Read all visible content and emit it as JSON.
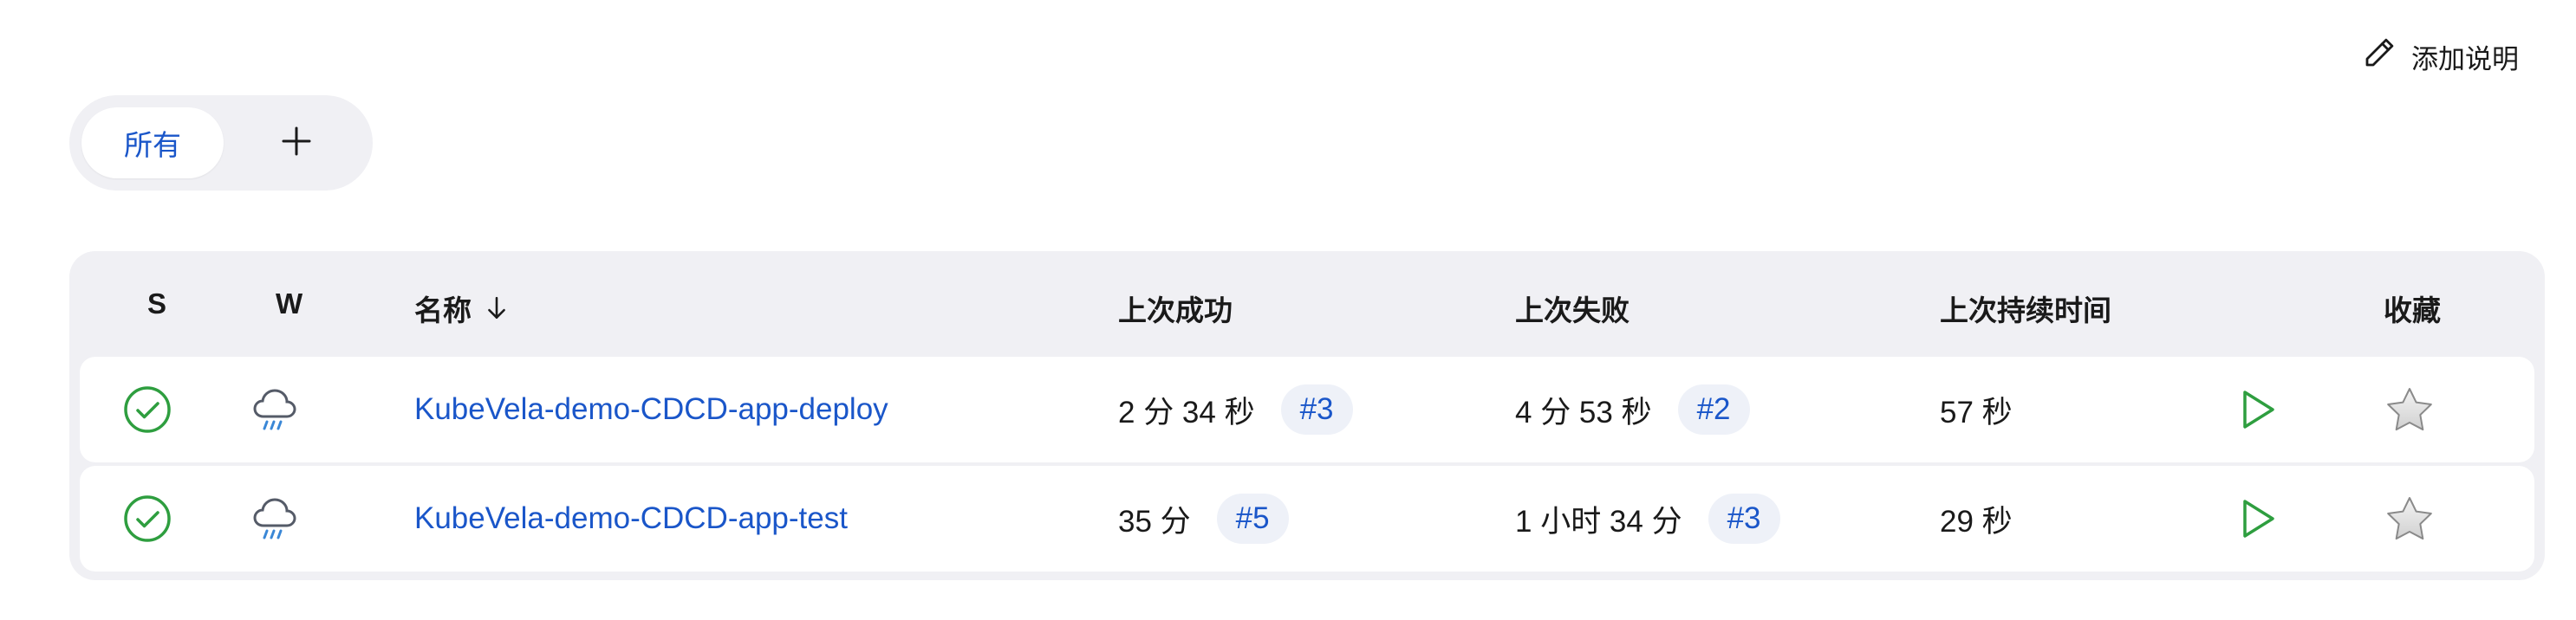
{
  "header": {
    "add_description_label": "添加说明"
  },
  "views": {
    "tabs": [
      {
        "label": "所有"
      }
    ],
    "add_icon": "plus-icon"
  },
  "table": {
    "columns": {
      "status": "S",
      "weather": "W",
      "name": "名称",
      "name_sort_icon": "arrow-down-icon",
      "last_success": "上次成功",
      "last_failure": "上次失败",
      "last_duration": "上次持续时间",
      "favorite": "收藏"
    },
    "rows": [
      {
        "status_icon": "success-check-icon",
        "weather_icon": "rain-cloud-icon",
        "name": "KubeVela-demo-CDCD-app-deploy",
        "last_success_time": "2 分 34 秒",
        "last_success_build": "#3",
        "last_failure_time": "4 分 53 秒",
        "last_failure_build": "#2",
        "last_duration": "57 秒",
        "run_icon": "play-icon",
        "favorite_icon": "star-icon"
      },
      {
        "status_icon": "success-check-icon",
        "weather_icon": "rain-cloud-icon",
        "name": "KubeVela-demo-CDCD-app-test",
        "last_success_time": "35 分",
        "last_success_build": "#5",
        "last_failure_time": "1 小时 34 分",
        "last_failure_build": "#3",
        "last_duration": "29 秒",
        "run_icon": "play-icon",
        "favorite_icon": "star-icon"
      }
    ]
  },
  "colors": {
    "accent": "#1a56c9",
    "success": "#2e9e3f",
    "panel_bg": "#f0f0f4"
  }
}
